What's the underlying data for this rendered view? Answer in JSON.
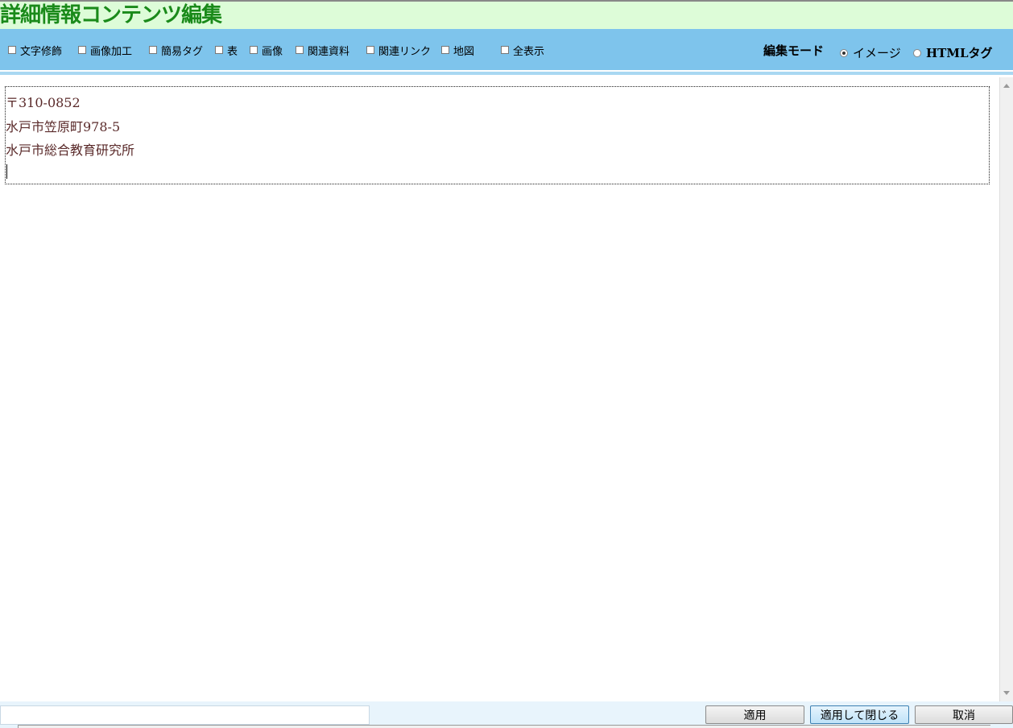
{
  "window": {
    "title": "詳細情報コンテンツ編集"
  },
  "toolbar": {
    "items": [
      {
        "label": "文字修飾",
        "checked": false
      },
      {
        "label": "画像加工",
        "checked": false
      },
      {
        "label": "簡易タグ",
        "checked": false
      },
      {
        "label": "表",
        "checked": false
      },
      {
        "label": "画像",
        "checked": false
      },
      {
        "label": "関連資料",
        "checked": false
      },
      {
        "label": "関連リンク",
        "checked": false
      },
      {
        "label": "地図",
        "checked": false
      },
      {
        "label": "全表示",
        "checked": false
      }
    ],
    "mode_label": "編集モード",
    "modes": [
      {
        "label": "イメージ",
        "selected": true
      },
      {
        "label": "HTMLタグ",
        "selected": false
      }
    ]
  },
  "editor": {
    "lines": [
      "〒310-0852",
      "水戸市笠原町978-5",
      "水戸市総合教育研究所"
    ]
  },
  "footer": {
    "input_value": "",
    "buttons": {
      "apply": "適用",
      "apply_close": "適用して閉じる",
      "cancel": "取消"
    }
  },
  "colors": {
    "title_bg": "#ddfcd8",
    "title_text": "#1a8a1a",
    "toolbar_bg": "#7ec4ec",
    "editor_text": "#5a2a2a"
  }
}
